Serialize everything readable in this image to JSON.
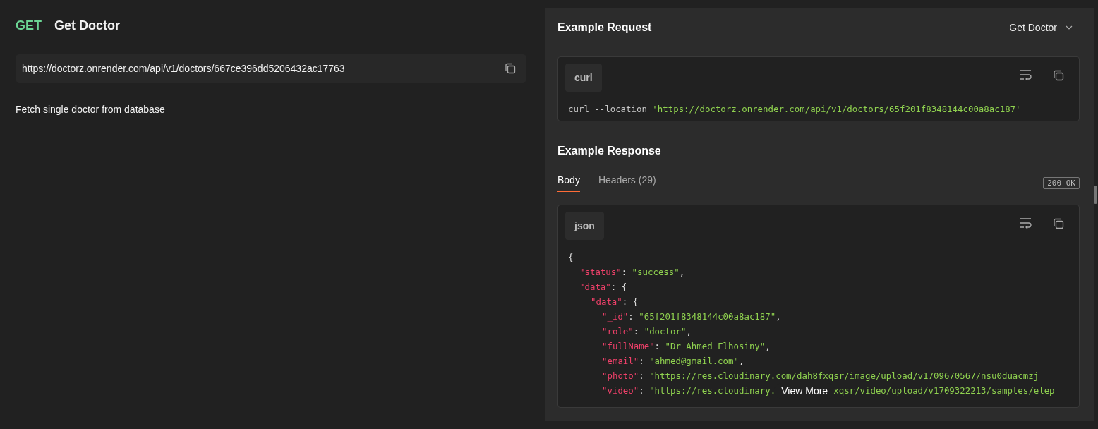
{
  "request": {
    "method": "GET",
    "title": "Get Doctor",
    "url": "https://doctorz.onrender.com/api/v1/doctors/667ce396dd5206432ac17763",
    "description": "Fetch single doctor from database"
  },
  "example_request": {
    "heading": "Example Request",
    "selector": "Get Doctor",
    "language": "curl",
    "code": [
      {
        "kind": "plain",
        "text": "curl --location "
      },
      {
        "kind": "str",
        "text": "'https://doctorz.onrender.com/api/v1/doctors/65f201f8348144c00a8ac187'"
      }
    ]
  },
  "example_response": {
    "heading": "Example Response",
    "tabs": [
      {
        "label": "Body",
        "selected": true
      },
      {
        "label": "Headers (29)",
        "selected": false
      }
    ],
    "status": "200 OK",
    "language": "json",
    "more_button": "View More",
    "lines": [
      {
        "tokens": [
          {
            "kind": "punct",
            "text": "{"
          }
        ],
        "children": [
          {
            "tokens": [
              {
                "kind": "key",
                "text": "\"status\""
              },
              {
                "kind": "punct",
                "text": ": "
              },
              {
                "kind": "str",
                "text": "\"success\""
              },
              {
                "kind": "punct",
                "text": ","
              }
            ]
          },
          {
            "tokens": [
              {
                "kind": "key",
                "text": "\"data\""
              },
              {
                "kind": "punct",
                "text": ": {"
              }
            ],
            "children": [
              {
                "tokens": [
                  {
                    "kind": "key",
                    "text": "\"data\""
                  },
                  {
                    "kind": "punct",
                    "text": ": {"
                  }
                ],
                "children": [
                  {
                    "tokens": [
                      {
                        "kind": "key",
                        "text": "\"_id\""
                      },
                      {
                        "kind": "punct",
                        "text": ": "
                      },
                      {
                        "kind": "str",
                        "text": "\"65f201f8348144c00a8ac187\""
                      },
                      {
                        "kind": "punct",
                        "text": ","
                      }
                    ]
                  },
                  {
                    "tokens": [
                      {
                        "kind": "key",
                        "text": "\"role\""
                      },
                      {
                        "kind": "punct",
                        "text": ": "
                      },
                      {
                        "kind": "str",
                        "text": "\"doctor\""
                      },
                      {
                        "kind": "punct",
                        "text": ","
                      }
                    ]
                  },
                  {
                    "tokens": [
                      {
                        "kind": "key",
                        "text": "\"fullName\""
                      },
                      {
                        "kind": "punct",
                        "text": ": "
                      },
                      {
                        "kind": "str",
                        "text": "\"Dr Ahmed Elhosiny\""
                      },
                      {
                        "kind": "punct",
                        "text": ","
                      }
                    ]
                  },
                  {
                    "tokens": [
                      {
                        "kind": "key",
                        "text": "\"email\""
                      },
                      {
                        "kind": "punct",
                        "text": ": "
                      },
                      {
                        "kind": "str",
                        "text": "\"ahmed@gmail.com\""
                      },
                      {
                        "kind": "punct",
                        "text": ","
                      }
                    ]
                  },
                  {
                    "tokens": [
                      {
                        "kind": "key",
                        "text": "\"photo\""
                      },
                      {
                        "kind": "punct",
                        "text": ": "
                      },
                      {
                        "kind": "str",
                        "text": "\"https://res.cloudinary.com/dah8fxqsr/image/upload/v1709670567/nsu0duacmzj"
                      }
                    ]
                  },
                  {
                    "tokens": [
                      {
                        "kind": "key",
                        "text": "\"video\""
                      },
                      {
                        "kind": "punct",
                        "text": ": "
                      },
                      {
                        "kind": "str",
                        "text": "\"https://res.cloudinary."
                      },
                      {
                        "kind": "gap"
                      },
                      {
                        "kind": "str",
                        "text": "xqsr/video/upload/v1709322213/samples/elep"
                      }
                    ]
                  }
                ]
              }
            ]
          }
        ]
      }
    ]
  }
}
